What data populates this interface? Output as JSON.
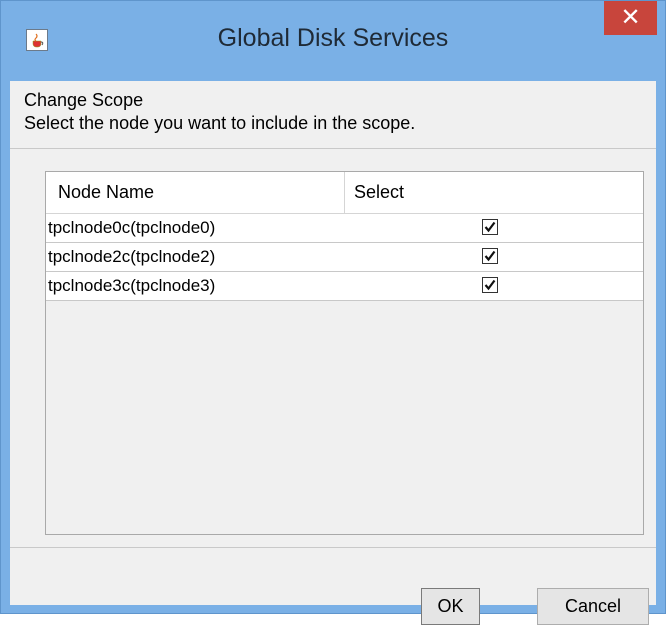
{
  "window": {
    "title": "Global Disk Services",
    "close_label": "✕"
  },
  "header": {
    "line1": "Change Scope",
    "line2": "Select the node you want to include in the scope."
  },
  "table": {
    "columns": [
      "Node Name",
      "Select"
    ],
    "rows": [
      {
        "name": "tpclnode0c(tpclnode0)",
        "selected": true
      },
      {
        "name": "tpclnode2c(tpclnode2)",
        "selected": true
      },
      {
        "name": "tpclnode3c(tpclnode3)",
        "selected": true
      }
    ]
  },
  "buttons": {
    "ok": "OK",
    "cancel": "Cancel"
  },
  "icons": {
    "app": "java-cup-icon",
    "close": "close-icon",
    "check": "checkmark-icon"
  }
}
